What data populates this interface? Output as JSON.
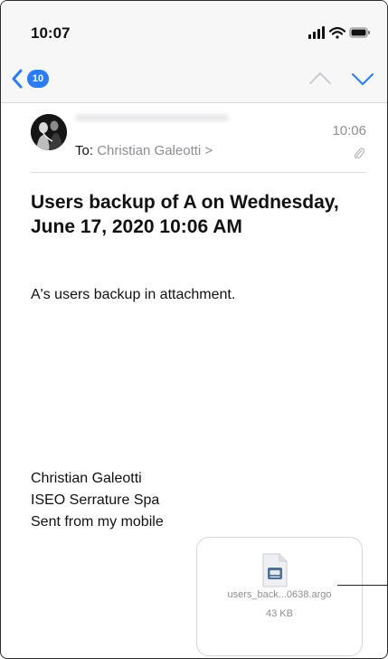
{
  "status_bar": {
    "time": "10:07"
  },
  "nav": {
    "unread_count": "10"
  },
  "message": {
    "to_label": "To:",
    "recipient": "Christian Galeotti >",
    "time": "10:06",
    "subject": "Users backup of A on Wednesday, June 17, 2020 10:06 AM",
    "body": "A's users backup in attachment.",
    "signature": {
      "line1": "Christian Galeotti",
      "line2": "ISEO Serrature Spa",
      "line3": "Sent from my mobile"
    }
  },
  "attachment": {
    "file_name": "users_back...0638.argo",
    "file_size": "43 KB"
  },
  "icons": {
    "back": "chevron-left-icon",
    "up": "chevron-up-icon",
    "down": "chevron-down-icon",
    "attachment": "paperclip-icon",
    "file": "document-icon"
  },
  "colors": {
    "accent": "#2a7cf7",
    "secondary_text": "#8e8e93",
    "bar_background": "#f7f7f8"
  }
}
